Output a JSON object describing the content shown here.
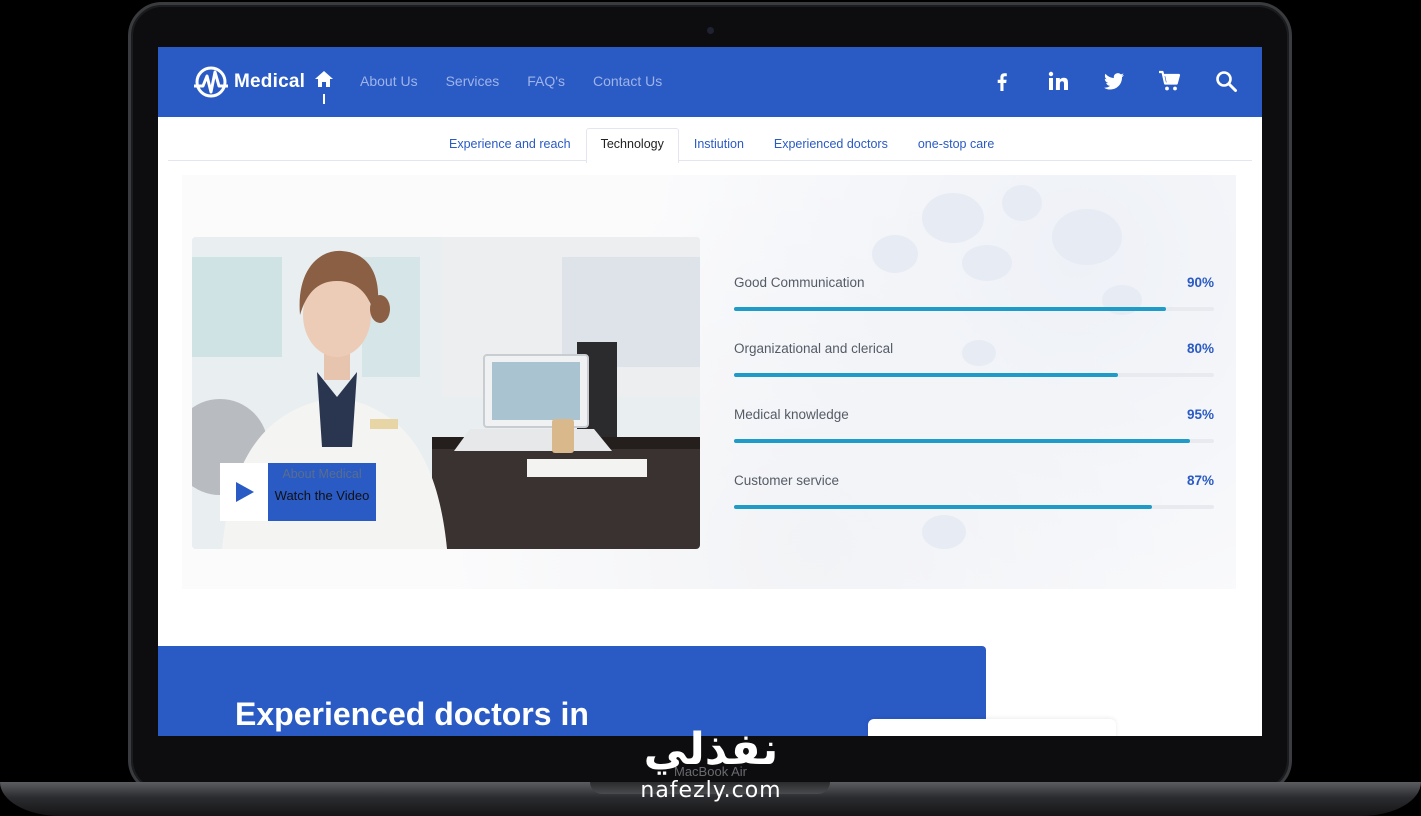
{
  "device": {
    "chin_label": "MacBook Air"
  },
  "brand": {
    "name": "Medical",
    "primary_color": "#2a5ac4",
    "progress_color": "#1f9bc8"
  },
  "nav": {
    "home_icon": "home-icon",
    "links": [
      "About Us",
      "Services",
      "FAQ's",
      "Contact Us"
    ],
    "social_icons": [
      "facebook-icon",
      "linkedin-icon",
      "twitter-icon",
      "cart-icon",
      "search-icon"
    ]
  },
  "tabs": {
    "items": [
      "Experience and reach",
      "Technology",
      "Instiution",
      "Experienced doctors",
      "one-stop care"
    ],
    "active": "Technology"
  },
  "video": {
    "subtitle": "About Medical",
    "label": "Watch the Video",
    "icon": "play-icon"
  },
  "skills": [
    {
      "label": "Good Communication",
      "percent_text": "90%",
      "percent": 90
    },
    {
      "label": "Organizational and clerical",
      "percent_text": "80%",
      "percent": 80
    },
    {
      "label": "Medical knowledge",
      "percent_text": "95%",
      "percent": 95
    },
    {
      "label": "Customer service",
      "percent_text": "87%",
      "percent": 87
    }
  ],
  "section": {
    "title": "Experienced doctors in"
  },
  "watermark": {
    "arabic": "نفذلي",
    "latin": "nafezly.com"
  }
}
